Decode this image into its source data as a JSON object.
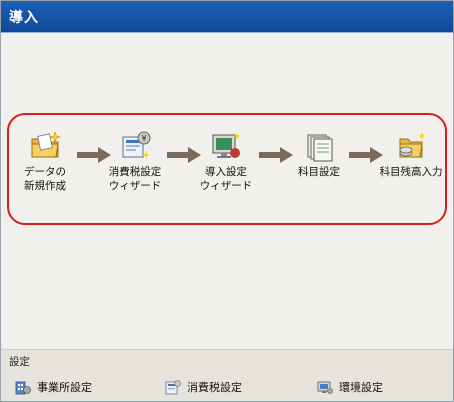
{
  "window": {
    "title": "導入"
  },
  "flow": {
    "steps": [
      {
        "label": "データの\n新規作成",
        "icon": "new-data-folder-icon"
      },
      {
        "label": "消費税設定\nウィザード",
        "icon": "tax-wizard-icon"
      },
      {
        "label": "導入設定\nウィザード",
        "icon": "setup-wizard-icon"
      },
      {
        "label": "科目設定",
        "icon": "account-cards-icon"
      },
      {
        "label": "科目残高入力",
        "icon": "balance-input-icon"
      }
    ]
  },
  "settings": {
    "section_label": "設定",
    "links": [
      {
        "label": "事業所設定",
        "icon": "office-settings-icon"
      },
      {
        "label": "消費税設定",
        "icon": "tax-settings-icon"
      },
      {
        "label": "環境設定",
        "icon": "environment-settings-icon"
      }
    ]
  },
  "colors": {
    "titlebar": "#1456a8",
    "highlight_border": "#d81e1e",
    "arrow": "#7a6a5a"
  }
}
